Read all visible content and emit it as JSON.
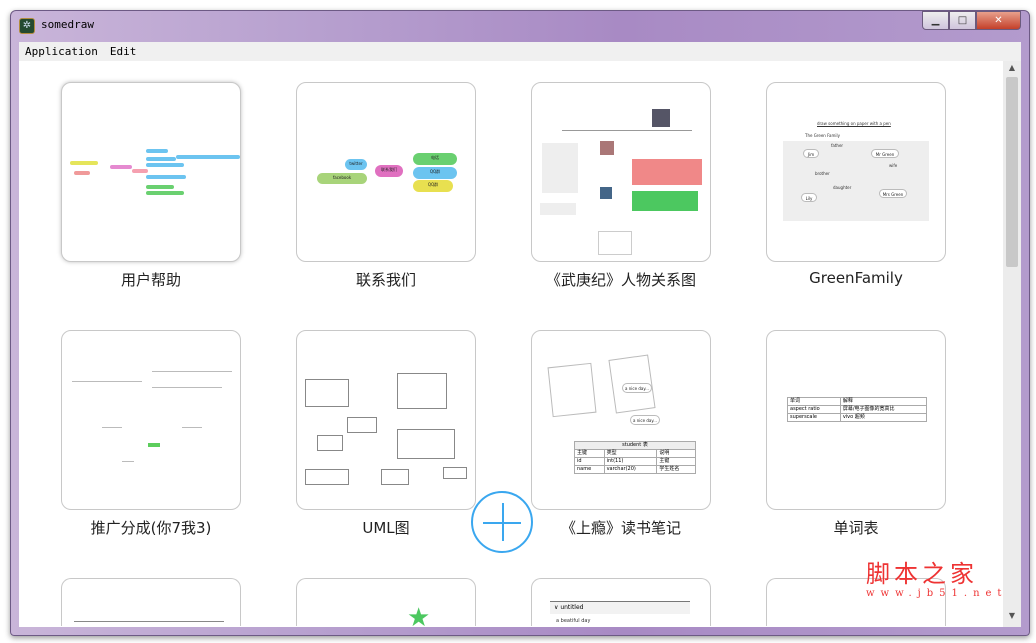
{
  "window": {
    "title": "somedraw",
    "minimize": "▁",
    "maximize": "□",
    "close": "✕"
  },
  "menu": [
    "Application",
    "Edit"
  ],
  "cards": [
    {
      "label": "用户帮助"
    },
    {
      "label": "联系我们",
      "nodes": [
        "twitter",
        "facebook",
        "联系我们",
        "电话",
        "QQ群",
        "QQ群"
      ]
    },
    {
      "label": "《武庚纪》人物关系图"
    },
    {
      "label": "GreenFamily",
      "heading": "draw something on paper with a pen",
      "subtitle": "The Green Family",
      "nodes": [
        "Jim",
        "Mr Green",
        "Mrs Green",
        "Lily"
      ],
      "edges": [
        "father",
        "wife",
        "daughter",
        "brother"
      ]
    },
    {
      "label": "推广分成(你7我3)"
    },
    {
      "label": "UML图"
    },
    {
      "label": "《上瘾》读书笔记",
      "bubbles": [
        "a nice day...",
        "a nice day..."
      ],
      "table": {
        "title": "student 表",
        "rows": [
          [
            "主键",
            "类型",
            "说明"
          ],
          [
            "id",
            "int(11)",
            "主键"
          ],
          [
            "name",
            "varchar(20)",
            "学生姓名"
          ]
        ]
      }
    },
    {
      "label": "单词表",
      "table": [
        [
          "单词",
          "解释"
        ],
        [
          "aspect ratio",
          "屏幕/电子图像的宽高比"
        ],
        [
          "superscale",
          "vivo 超频"
        ]
      ]
    },
    {
      "label": ""
    },
    {
      "label": ""
    },
    {
      "label": "",
      "header": "untitled",
      "text": "a beatiful day"
    },
    {
      "label": ""
    }
  ],
  "fab_label": "+",
  "watermark": {
    "line1": "脚本之家",
    "line2": "www.jb51.net"
  }
}
